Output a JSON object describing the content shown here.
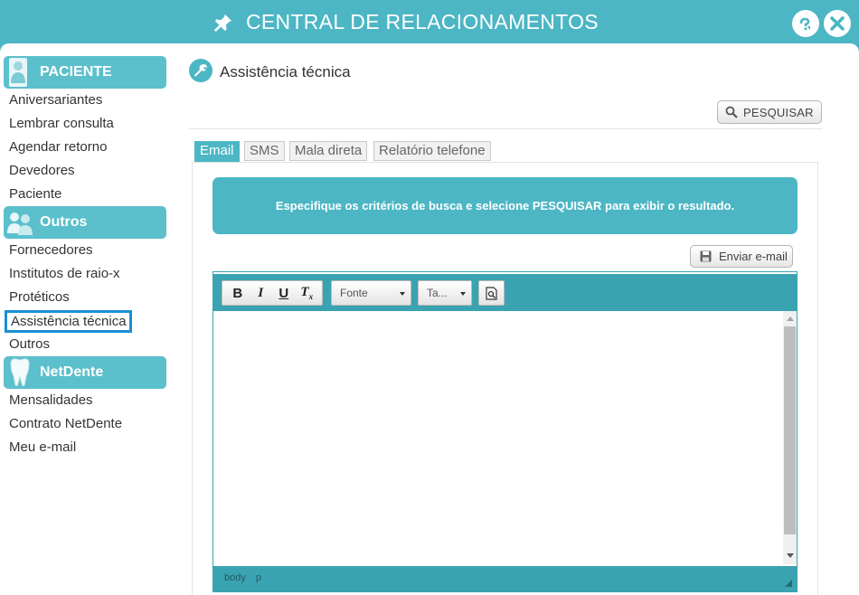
{
  "window": {
    "title": "CENTRAL DE RELACIONAMENTOS",
    "help_icon": "help-question-icon",
    "close_icon": "close-x-icon"
  },
  "sidebar": {
    "sections": [
      {
        "label": "PACIENTE",
        "icon": "patient-person-icon",
        "items": [
          "Aniversariantes",
          "Lembrar consulta",
          "Agendar retorno",
          "Devedores",
          "Paciente"
        ]
      },
      {
        "label": "Outros",
        "icon": "group-people-icon",
        "items": [
          "Fornecedores",
          "Institutos de raio-x",
          "Protéticos",
          "Assistência técnica",
          "Outros"
        ]
      },
      {
        "label": "NetDente",
        "icon": "tooth-icon",
        "items": [
          "Mensalidades",
          "Contrato NetDente",
          "Meu e-mail"
        ]
      }
    ],
    "selected_item": "Assistência técnica"
  },
  "content": {
    "title": "Assistência técnica",
    "icon": "wrench-icon",
    "search_button": "PESQUISAR",
    "tabs": [
      "Email",
      "SMS",
      "Mala direta",
      "Relatório telefone"
    ],
    "active_tab": "Email",
    "info_message": "Especifique os critérios de busca e selecione PESQUISAR para exibir o resultado.",
    "send_email_button": "Enviar e-mail"
  },
  "editor": {
    "font_combo": "Fonte",
    "size_combo": "Ta...",
    "status_path": [
      "body",
      "p"
    ]
  },
  "colors": {
    "accent": "#4cb6c4",
    "accent_dark": "#3aa3b1",
    "selection_border": "#1a8fd6"
  }
}
